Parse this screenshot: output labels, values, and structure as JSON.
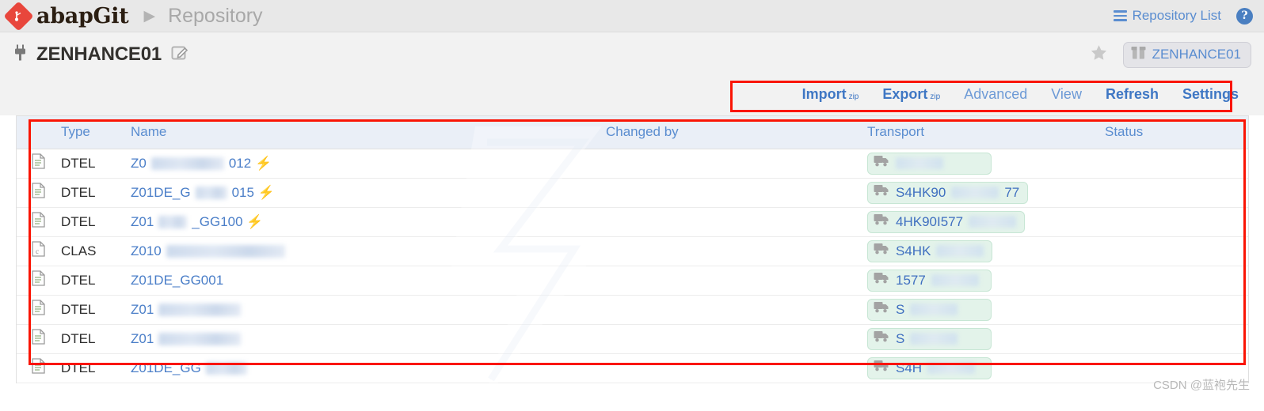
{
  "header": {
    "brand": "abapGit",
    "separator": "▶",
    "section": "Repository",
    "repository_list_label": "Repository List",
    "help_label": "?",
    "icons": {
      "logo": "abapgit-diamond-logo",
      "menu": "hamburger-icon",
      "help": "help-icon"
    }
  },
  "repo": {
    "name": "ZENHANCE01",
    "package_label": "ZENHANCE01",
    "icons": {
      "plug": "plug-icon",
      "edit": "edit-icon",
      "star": "star-icon",
      "package": "package-icon"
    }
  },
  "toolbar": {
    "items": [
      {
        "label": "Import",
        "sup": "zip",
        "style": "bold"
      },
      {
        "label": "Export",
        "sup": "zip",
        "style": "bold"
      },
      {
        "label": "Advanced",
        "sup": "",
        "style": "light"
      },
      {
        "label": "View",
        "sup": "",
        "style": "light"
      },
      {
        "label": "Refresh",
        "sup": "",
        "style": "bold"
      },
      {
        "label": "Settings",
        "sup": "",
        "style": "bold"
      }
    ]
  },
  "table": {
    "columns": [
      "Type",
      "Name",
      "Changed by",
      "Transport",
      "Status"
    ],
    "rows": [
      {
        "icon": "file-icon",
        "type": "DTEL",
        "name": "Z0",
        "name_redacted": true,
        "redact_width": 92,
        "name_tail": "012",
        "bolt": true,
        "transport": "",
        "transport_redacted": true,
        "changed_by": "",
        "status": ""
      },
      {
        "icon": "file-icon",
        "type": "DTEL",
        "name": "Z01DE_G",
        "name_redacted": true,
        "redact_width": 40,
        "name_tail": "015",
        "bolt": true,
        "transport": "S4HK90",
        "transport_redacted": true,
        "transport_tail": "77",
        "changed_by": "",
        "status": ""
      },
      {
        "icon": "file-icon",
        "type": "DTEL",
        "name": "Z01",
        "name_redacted": true,
        "redact_width": 36,
        "name_tail": "_GG100",
        "bolt": true,
        "transport": "4HK90I577",
        "transport_redacted": true,
        "changed_by": "",
        "status": ""
      },
      {
        "icon": "class-icon",
        "type": "CLAS",
        "name": "Z010",
        "name_redacted": true,
        "redact_width": 150,
        "name_tail": "",
        "bolt": false,
        "transport": "S4HK",
        "transport_redacted": true,
        "changed_by": "",
        "status": ""
      },
      {
        "icon": "file-icon",
        "type": "DTEL",
        "name": "Z01DE_GG001",
        "name_redacted": false,
        "redact_width": 0,
        "name_tail": "",
        "bolt": false,
        "transport": "1577",
        "transport_redacted": true,
        "changed_by": "",
        "status": ""
      },
      {
        "icon": "file-icon",
        "type": "DTEL",
        "name": "Z01",
        "name_redacted": true,
        "redact_width": 104,
        "name_tail": "",
        "bolt": false,
        "transport": "S",
        "transport_redacted": true,
        "changed_by": "",
        "status": ""
      },
      {
        "icon": "file-icon",
        "type": "DTEL",
        "name": "Z01",
        "name_redacted": true,
        "redact_width": 104,
        "name_tail": "",
        "bolt": false,
        "transport": "S",
        "transport_redacted": true,
        "changed_by": "",
        "status": ""
      },
      {
        "icon": "file-icon",
        "type": "DTEL",
        "name": "Z01DE_GG",
        "name_redacted": true,
        "redact_width": 52,
        "name_tail": "",
        "bolt": false,
        "transport": "S4H",
        "transport_redacted": true,
        "changed_by": "",
        "status": ""
      }
    ]
  },
  "watermark": {
    "text": "CSDN @蓝袍先生"
  },
  "colors": {
    "accent_blue": "#4a7ec8",
    "link_blue": "#5a8dd0",
    "logo_red": "#e8463c",
    "annotation_red": "#fa1505",
    "bolt_orange": "#f5a623",
    "transport_green_bg": "#e3f3ea",
    "header_bg": "#e8e8e8",
    "table_header_bg": "#eaeff7"
  }
}
